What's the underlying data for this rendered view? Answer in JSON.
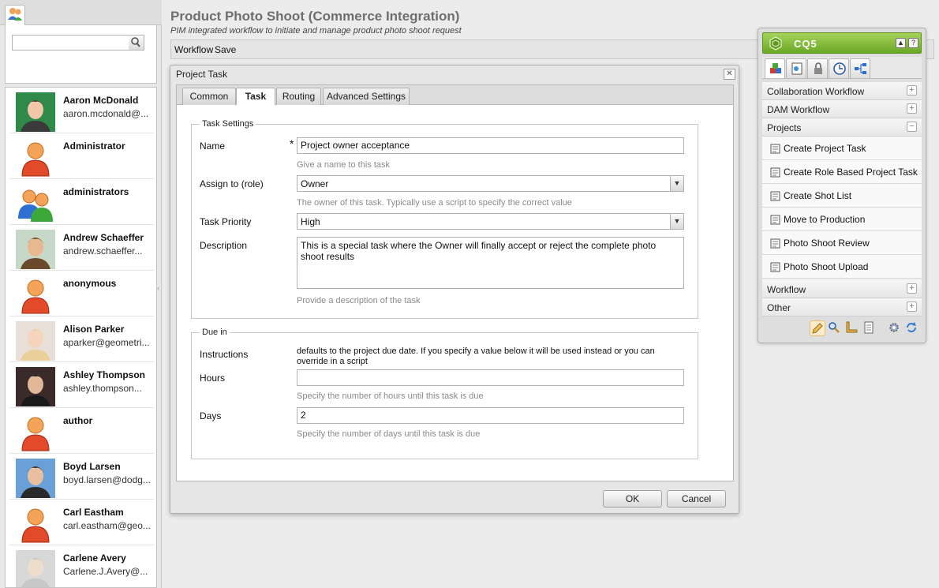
{
  "page": {
    "title": "Product Photo Shoot (Commerce Integration)",
    "subtitle": "PIM integrated workflow to initiate and manage product photo shoot request"
  },
  "toolbar": {
    "workflow_label": "Workflow",
    "save_label": "Save"
  },
  "users": {
    "search_value": "",
    "items": [
      {
        "name": "Aaron McDonald",
        "email": "aaron.mcdonald@...",
        "avatar": "photo"
      },
      {
        "name": "Administrator",
        "email": "",
        "avatar": "generic-user"
      },
      {
        "name": "administrators",
        "email": "",
        "avatar": "group"
      },
      {
        "name": "Andrew Schaeffer",
        "email": "andrew.schaeffer...",
        "avatar": "photo"
      },
      {
        "name": "anonymous",
        "email": "",
        "avatar": "generic-user"
      },
      {
        "name": "Alison Parker",
        "email": "aparker@geometri...",
        "avatar": "photo"
      },
      {
        "name": "Ashley Thompson",
        "email": "ashley.thompson...",
        "avatar": "photo"
      },
      {
        "name": "author",
        "email": "",
        "avatar": "generic-user"
      },
      {
        "name": "Boyd Larsen",
        "email": "boyd.larsen@dodg...",
        "avatar": "photo"
      },
      {
        "name": "Carl Eastham",
        "email": "carl.eastham@geo...",
        "avatar": "generic-user"
      },
      {
        "name": "Carlene Avery",
        "email": "Carlene.J.Avery@...",
        "avatar": "photo"
      }
    ]
  },
  "dialog": {
    "title": "Project Task",
    "close_symbol": "✕",
    "tabs": [
      {
        "label": "Common"
      },
      {
        "label": "Task"
      },
      {
        "label": "Routing"
      },
      {
        "label": "Advanced Settings"
      }
    ],
    "active_tab": "Task",
    "task_settings": {
      "legend": "Task Settings",
      "name_label": "Name",
      "required_marker": "*",
      "name_value": "Project owner acceptance",
      "name_help": "Give a name to this task",
      "assign_label": "Assign to (role)",
      "assign_value": "Owner",
      "assign_help": "The owner of this task. Typically use a script to specify the correct value",
      "priority_label": "Task Priority",
      "priority_value": "High",
      "description_label": "Description",
      "description_value": "This is a special task where the Owner will finally accept or reject the complete photo shoot results",
      "description_help": "Provide a description of the task"
    },
    "due_in": {
      "legend": "Due in",
      "instructions_label": "Instructions",
      "instructions_text": "defaults to the project due date. If you specify a value below it will be used instead or you can override in a script",
      "hours_label": "Hours",
      "hours_value": "",
      "hours_help": "Specify the number of hours until this task is due",
      "days_label": "Days",
      "days_value": "2",
      "days_help": "Specify the number of days until this task is due"
    },
    "ok_label": "OK",
    "cancel_label": "Cancel"
  },
  "sidekick": {
    "title": "CQ5",
    "accent_color": "#7cb92e",
    "groups": [
      {
        "label": "Collaboration Workflow",
        "toggle": "+"
      },
      {
        "label": "DAM Workflow",
        "toggle": "+"
      },
      {
        "label": "Projects",
        "toggle": "−"
      },
      {
        "label": "Workflow",
        "toggle": "+"
      },
      {
        "label": "Other",
        "toggle": "+"
      }
    ],
    "project_items": [
      {
        "label": "Create Project Task"
      },
      {
        "label": "Create Role Based Project Task"
      },
      {
        "label": "Create Shot List"
      },
      {
        "label": "Move to Production"
      },
      {
        "label": "Photo Shoot Review"
      },
      {
        "label": "Photo Shoot Upload"
      }
    ]
  }
}
